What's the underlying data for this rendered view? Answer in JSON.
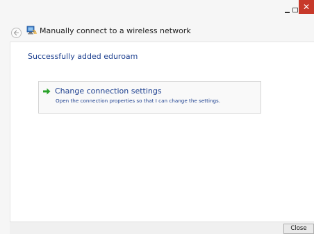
{
  "window": {
    "controls": {
      "minimize_icon": "minimize-icon",
      "maximize_icon": "maximize-icon",
      "close_glyph": "✕",
      "close_color": "#c7392a"
    }
  },
  "header": {
    "back_icon": "back-arrow-icon",
    "wifi_icon": "wireless-network-icon",
    "title": "Manually connect to a wireless network"
  },
  "main": {
    "success_message": "Successfully added eduroam",
    "options": [
      {
        "icon": "green-arrow-icon",
        "title": "Change connection settings",
        "description": "Open the connection properties so that I can change the settings."
      }
    ]
  },
  "footer": {
    "close_label": "Close"
  },
  "colors": {
    "link_blue": "#1c3f8f",
    "arrow_green": "#2aa32a",
    "titlebar_bg": "#f6f6f6"
  }
}
